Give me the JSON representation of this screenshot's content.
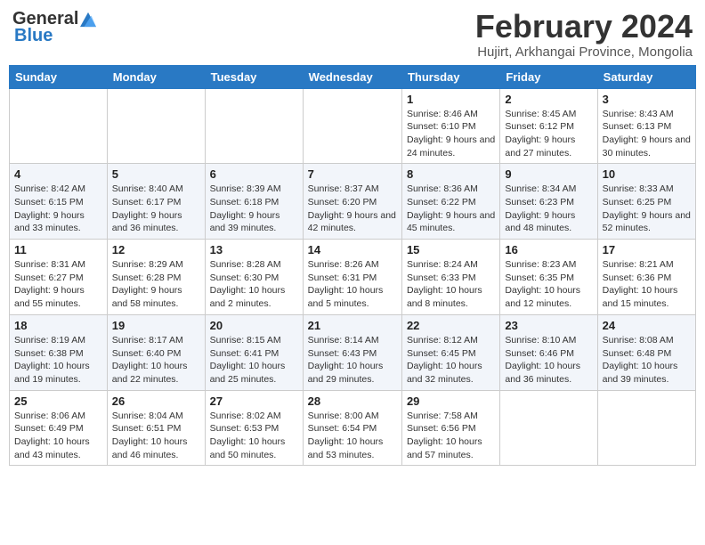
{
  "header": {
    "logo_general": "General",
    "logo_blue": "Blue",
    "main_title": "February 2024",
    "subtitle": "Hujirt, Arkhangai Province, Mongolia"
  },
  "days_of_week": [
    "Sunday",
    "Monday",
    "Tuesday",
    "Wednesday",
    "Thursday",
    "Friday",
    "Saturday"
  ],
  "weeks": [
    [
      {
        "day": "",
        "info": ""
      },
      {
        "day": "",
        "info": ""
      },
      {
        "day": "",
        "info": ""
      },
      {
        "day": "",
        "info": ""
      },
      {
        "day": "1",
        "info": "Sunrise: 8:46 AM\nSunset: 6:10 PM\nDaylight: 9 hours and 24 minutes."
      },
      {
        "day": "2",
        "info": "Sunrise: 8:45 AM\nSunset: 6:12 PM\nDaylight: 9 hours and 27 minutes."
      },
      {
        "day": "3",
        "info": "Sunrise: 8:43 AM\nSunset: 6:13 PM\nDaylight: 9 hours and 30 minutes."
      }
    ],
    [
      {
        "day": "4",
        "info": "Sunrise: 8:42 AM\nSunset: 6:15 PM\nDaylight: 9 hours and 33 minutes."
      },
      {
        "day": "5",
        "info": "Sunrise: 8:40 AM\nSunset: 6:17 PM\nDaylight: 9 hours and 36 minutes."
      },
      {
        "day": "6",
        "info": "Sunrise: 8:39 AM\nSunset: 6:18 PM\nDaylight: 9 hours and 39 minutes."
      },
      {
        "day": "7",
        "info": "Sunrise: 8:37 AM\nSunset: 6:20 PM\nDaylight: 9 hours and 42 minutes."
      },
      {
        "day": "8",
        "info": "Sunrise: 8:36 AM\nSunset: 6:22 PM\nDaylight: 9 hours and 45 minutes."
      },
      {
        "day": "9",
        "info": "Sunrise: 8:34 AM\nSunset: 6:23 PM\nDaylight: 9 hours and 48 minutes."
      },
      {
        "day": "10",
        "info": "Sunrise: 8:33 AM\nSunset: 6:25 PM\nDaylight: 9 hours and 52 minutes."
      }
    ],
    [
      {
        "day": "11",
        "info": "Sunrise: 8:31 AM\nSunset: 6:27 PM\nDaylight: 9 hours and 55 minutes."
      },
      {
        "day": "12",
        "info": "Sunrise: 8:29 AM\nSunset: 6:28 PM\nDaylight: 9 hours and 58 minutes."
      },
      {
        "day": "13",
        "info": "Sunrise: 8:28 AM\nSunset: 6:30 PM\nDaylight: 10 hours and 2 minutes."
      },
      {
        "day": "14",
        "info": "Sunrise: 8:26 AM\nSunset: 6:31 PM\nDaylight: 10 hours and 5 minutes."
      },
      {
        "day": "15",
        "info": "Sunrise: 8:24 AM\nSunset: 6:33 PM\nDaylight: 10 hours and 8 minutes."
      },
      {
        "day": "16",
        "info": "Sunrise: 8:23 AM\nSunset: 6:35 PM\nDaylight: 10 hours and 12 minutes."
      },
      {
        "day": "17",
        "info": "Sunrise: 8:21 AM\nSunset: 6:36 PM\nDaylight: 10 hours and 15 minutes."
      }
    ],
    [
      {
        "day": "18",
        "info": "Sunrise: 8:19 AM\nSunset: 6:38 PM\nDaylight: 10 hours and 19 minutes."
      },
      {
        "day": "19",
        "info": "Sunrise: 8:17 AM\nSunset: 6:40 PM\nDaylight: 10 hours and 22 minutes."
      },
      {
        "day": "20",
        "info": "Sunrise: 8:15 AM\nSunset: 6:41 PM\nDaylight: 10 hours and 25 minutes."
      },
      {
        "day": "21",
        "info": "Sunrise: 8:14 AM\nSunset: 6:43 PM\nDaylight: 10 hours and 29 minutes."
      },
      {
        "day": "22",
        "info": "Sunrise: 8:12 AM\nSunset: 6:45 PM\nDaylight: 10 hours and 32 minutes."
      },
      {
        "day": "23",
        "info": "Sunrise: 8:10 AM\nSunset: 6:46 PM\nDaylight: 10 hours and 36 minutes."
      },
      {
        "day": "24",
        "info": "Sunrise: 8:08 AM\nSunset: 6:48 PM\nDaylight: 10 hours and 39 minutes."
      }
    ],
    [
      {
        "day": "25",
        "info": "Sunrise: 8:06 AM\nSunset: 6:49 PM\nDaylight: 10 hours and 43 minutes."
      },
      {
        "day": "26",
        "info": "Sunrise: 8:04 AM\nSunset: 6:51 PM\nDaylight: 10 hours and 46 minutes."
      },
      {
        "day": "27",
        "info": "Sunrise: 8:02 AM\nSunset: 6:53 PM\nDaylight: 10 hours and 50 minutes."
      },
      {
        "day": "28",
        "info": "Sunrise: 8:00 AM\nSunset: 6:54 PM\nDaylight: 10 hours and 53 minutes."
      },
      {
        "day": "29",
        "info": "Sunrise: 7:58 AM\nSunset: 6:56 PM\nDaylight: 10 hours and 57 minutes."
      },
      {
        "day": "",
        "info": ""
      },
      {
        "day": "",
        "info": ""
      }
    ]
  ]
}
